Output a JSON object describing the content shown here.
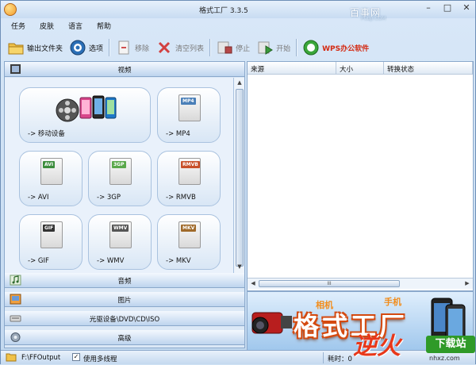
{
  "window": {
    "title": "格式工厂  3.3.5",
    "watermark": "百事网",
    "watermark_sub": "PCBJI.COM",
    "minimize": "–",
    "maximize": "□",
    "close": "✕"
  },
  "menubar": [
    "任务",
    "皮肤",
    "语言",
    "帮助"
  ],
  "toolbar": {
    "output_folder": "输出文件夹",
    "options": "选项",
    "remove": "移除",
    "clear_list": "清空列表",
    "stop": "停止",
    "start": "开始",
    "wps": "WPS办公软件"
  },
  "categories": {
    "video": "视频",
    "audio": "音频",
    "image": "图片",
    "disc": "光驱设备\\DVD\\CD\\ISO",
    "advanced": "高级"
  },
  "video_tiles": [
    {
      "label": "-> 移动设备",
      "icon": "mobile-device-icon"
    },
    {
      "label": "-> MP4",
      "badge": "MP4",
      "icon": "mp4-file-icon"
    },
    {
      "label": "-> AVI",
      "badge": "AVI",
      "icon": "avi-file-icon"
    },
    {
      "label": "-> 3GP",
      "badge": "3GP",
      "icon": "3gp-file-icon"
    },
    {
      "label": "-> RMVB",
      "badge": "RMVB",
      "icon": "rmvb-file-icon"
    },
    {
      "label": "-> GIF",
      "badge": "GIF",
      "icon": "gif-file-icon"
    },
    {
      "label": "-> WMV",
      "badge": "WMV",
      "icon": "wmv-file-icon"
    },
    {
      "label": "-> MKV",
      "badge": "MKV",
      "icon": "mkv-file-icon"
    }
  ],
  "file_list": {
    "columns": [
      "来源",
      "大小",
      "转换状态"
    ],
    "scroll_grip": "III"
  },
  "banner": {
    "title": "格式工厂",
    "tag_left": "相机",
    "tag_right": "手机"
  },
  "statusbar": {
    "output_path": "F:\\FFOutput",
    "multithread_label": "使用多线程",
    "multithread_checked": "✓",
    "elapsed_label": "耗时：0"
  },
  "site_logo": {
    "big": "逆火",
    "badge": "下载站",
    "url": "nhxz.com"
  },
  "colors": {
    "accent": "#d42a12",
    "window_bg": "#c3d9f0",
    "header_gradient_end": "#bdd4ee"
  }
}
